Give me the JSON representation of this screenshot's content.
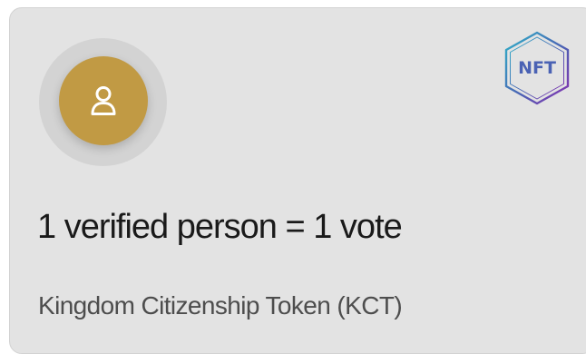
{
  "card": {
    "headline": "1 verified person = 1 vote",
    "subtitle": "Kingdom Citizenship Token (KCT)",
    "avatar_icon": "user-icon",
    "badge": {
      "label": "NFT",
      "icon": "hexagon-icon"
    }
  },
  "colors": {
    "card_background": "#e3e3e3",
    "avatar_ring": "#d3d3d3",
    "avatar_fill": "#c19a44",
    "badge_text": "#4a62b4",
    "badge_gradient_start": "#2fb3c9",
    "badge_gradient_end": "#8a2fb0"
  }
}
